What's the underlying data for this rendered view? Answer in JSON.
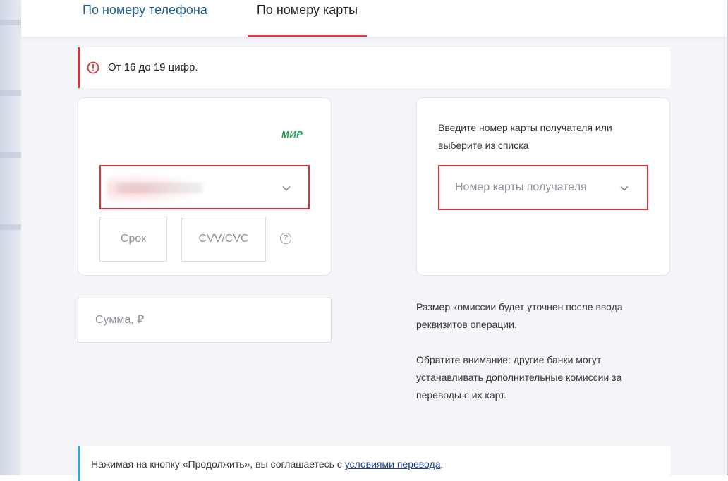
{
  "tabs": {
    "phone_label": "По номеру телефона",
    "card_label": "По номеру карты"
  },
  "alert": {
    "text": "От 16 до 19 цифр.",
    "icon": "error-info-icon"
  },
  "sender": {
    "payment_system": "МИР",
    "expiry_placeholder": "Срок",
    "cvv_placeholder": "CVV/CVC",
    "help_symbol": "?"
  },
  "amount": {
    "placeholder": "Сумма, ₽"
  },
  "recipient": {
    "hint": "Введите номер карты получателя или выберите из списка",
    "placeholder": "Номер карты получателя"
  },
  "info": {
    "commission": "Размер комиссии будет уточнен после ввода реквизитов операции.",
    "banks_note": "Обратите внимание: другие банки могут устанавливать дополнительные комиссии за переводы с их карт."
  },
  "agreement": {
    "prefix": "Нажимая на кнопку «Продолжить», вы соглашаетесь с ",
    "link": "условиями перевода",
    "suffix": "."
  },
  "colors": {
    "error": "#d8333a",
    "accent_tab": "#e03a3e",
    "mir_green": "#1c9e52",
    "link": "#1b3f9a"
  }
}
